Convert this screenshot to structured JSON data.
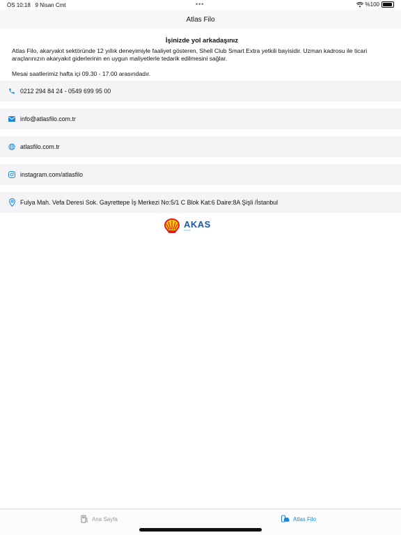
{
  "status_bar": {
    "time": "ÖS 10:18",
    "date": "9 Nisan Cmt",
    "battery": "%100"
  },
  "nav": {
    "title": "Atlas Filo"
  },
  "intro": {
    "heading": "İşinizde yol arkadaşınız",
    "paragraph1": "Atlas Filo, akaryakıt sektöründe 12 yıllık deneyimiyle faaliyet gösteren, Shell Club Smart Extra yetkili bayisidir. Uzman kadrosu ile ticari araçlarınızın akaryakıt giderlerinin en uygun maliyetlerle tedarik edilmesini sağlar.",
    "paragraph2": "Mesai saatlerimiz hafta içi 09.30 - 17.00 arasındadır."
  },
  "contacts": [
    {
      "icon": "phone-icon",
      "text": "0212 294 84 24 - 0549 699 95 00"
    },
    {
      "icon": "mail-icon",
      "text": "info@atlasfilo.com.tr"
    },
    {
      "icon": "globe-icon",
      "text": "atlasfilo.com.tr"
    },
    {
      "icon": "instagram-icon",
      "text": "instagram.com/atlasfilo"
    },
    {
      "icon": "location-pin-icon",
      "text": "Fulya Mah. Vefa Deresi Sok. Gayrettepe İş Merkezi No:5/1 C Blok Kat:6 Daire:8A Şişli /İstanbul"
    }
  ],
  "logos": {
    "akas_name": "AKAS",
    "akas_sub": "ATLAS"
  },
  "tabbar": {
    "home_label": "Ana Sayfa",
    "atlas_label": "Atlas Filo"
  },
  "colors": {
    "accent": "#1a8ad8",
    "row_bg": "#f4f4f6",
    "shell_red": "#dd1d21",
    "shell_yellow": "#fbce07"
  }
}
